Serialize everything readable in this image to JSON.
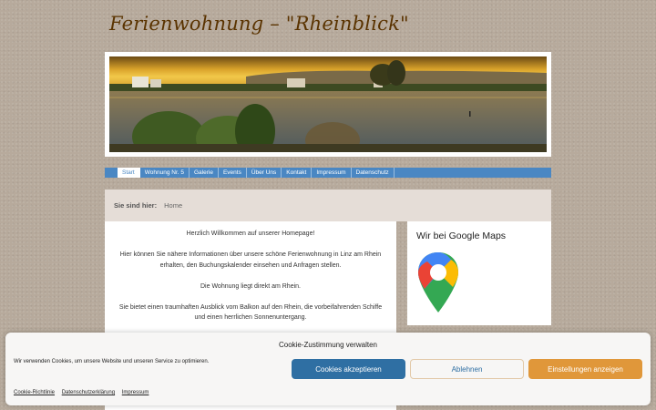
{
  "site": {
    "title": "Ferienwohnung – \"Rheinblick\""
  },
  "nav": {
    "items": [
      {
        "label": "Start",
        "active": true
      },
      {
        "label": "Wohnung Nr. 5",
        "active": false
      },
      {
        "label": "Galerie",
        "active": false
      },
      {
        "label": "Events",
        "active": false
      },
      {
        "label": "Über Uns",
        "active": false
      },
      {
        "label": "Kontakt",
        "active": false
      },
      {
        "label": "Impressum",
        "active": false
      },
      {
        "label": "Datenschutz",
        "active": false
      }
    ]
  },
  "breadcrumb": {
    "label": "Sie sind hier:",
    "current": "Home"
  },
  "main": {
    "paragraphs": [
      "Herzlich Willkommen auf unserer Homepage!",
      "Hier können Sie nähere Informationen über unsere schöne Ferienwohnung in Linz am Rhein erhalten,  den Buchungskalender einsehen und Anfragen stellen.",
      "Die Wohnung liegt direkt am Rhein.",
      "Sie bietet einen traumhaften Ausblick vom Balkon auf den Rhein, die vorbeifahrenden Schiffe und einen herrlichen Sonnenuntergang."
    ]
  },
  "sidebar": {
    "title": "Wir bei Google Maps",
    "icon": "google-maps-pin-icon"
  },
  "cookie": {
    "title": "Cookie-Zustimmung verwalten",
    "text": "Wir verwenden Cookies, um unsere Website und unseren Service zu optimieren.",
    "accept_label": "Cookies akzeptieren",
    "deny_label": "Ablehnen",
    "settings_label": "Einstellungen anzeigen",
    "links": [
      "Cookie-Richtlinie",
      "Datenschutzerklärung",
      "Impressum"
    ]
  },
  "colors": {
    "nav_blue": "#4a87c3",
    "title_brown": "#5a3300",
    "accept_blue": "#2f6fa3",
    "settings_orange": "#e0973a"
  }
}
